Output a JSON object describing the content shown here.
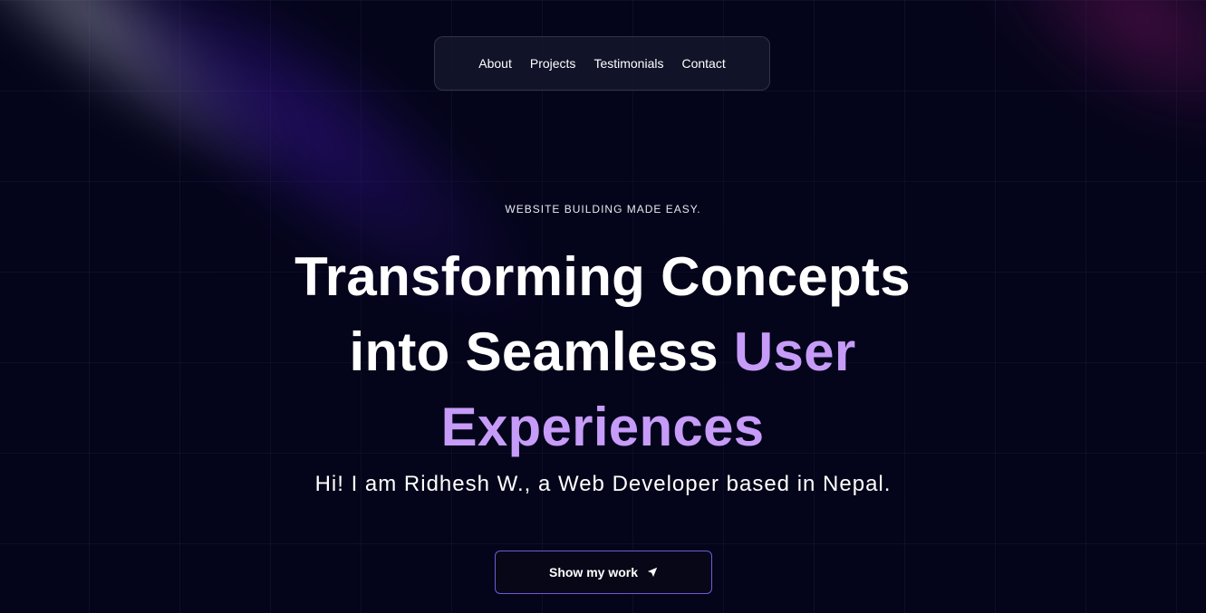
{
  "nav": {
    "items": [
      {
        "label": "About"
      },
      {
        "label": "Projects"
      },
      {
        "label": "Testimonials"
      },
      {
        "label": "Contact"
      }
    ]
  },
  "hero": {
    "eyebrow": "WEBSITE BUILDING MADE EASY.",
    "headline_white": "Transforming Concepts into Seamless ",
    "headline_accent": "User Experiences",
    "subline": "Hi! I am Ridhesh W., a Web Developer based in Nepal.",
    "cta_label": "Show my work",
    "cta_icon": "send-arrow-icon"
  },
  "colors": {
    "background": "#04041a",
    "accent": "#c69cf8",
    "cta_border": "#6f5bd8",
    "nav_background": "#14162c"
  }
}
